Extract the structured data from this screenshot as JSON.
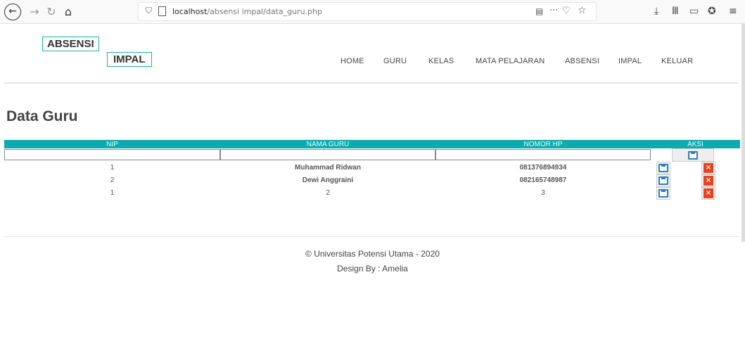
{
  "browser": {
    "url_host": "localhost",
    "url_path": "/absensi impal/data_guru.php",
    "icons": {
      "back": "←",
      "forward": "→",
      "reload": "↻",
      "home": "⌂",
      "shield": "⛉",
      "reader": "▤",
      "more": "···",
      "pocket": "♡",
      "star": "☆",
      "download": "⤓",
      "library": "Ⅲ",
      "sidebar": "▭",
      "extension": "✪",
      "menu": "≡"
    }
  },
  "brand": {
    "line1": "ABSENSI",
    "line2": "IMPAL",
    "accent_color": "#19b3b3"
  },
  "menu": [
    {
      "label": "HOME"
    },
    {
      "label": "GURU"
    },
    {
      "label": "KELAS"
    },
    {
      "label": "MATA PELAJARAN"
    },
    {
      "label": "ABSENSI"
    },
    {
      "label": "IMPAL"
    },
    {
      "label": "KELUAR"
    }
  ],
  "page_title": "Data Guru",
  "table": {
    "header_color": "#10aaae",
    "columns": [
      "NIP",
      "NAMA GURU",
      "NOMOR HP",
      "AKSI"
    ],
    "filter_values": [
      "",
      "",
      ""
    ],
    "rows": [
      {
        "nip": "1",
        "nama": "Muhammad Ridwan",
        "hp": "081376894934"
      },
      {
        "nip": "2",
        "nama": "Dewi Anggraini",
        "hp": "082165748987"
      },
      {
        "nip": "1",
        "nama": "2",
        "hp": "3"
      }
    ]
  },
  "footer": {
    "copyright": "© Universitas Potensi Utama - 2020",
    "design": "Design By : Amelia"
  }
}
